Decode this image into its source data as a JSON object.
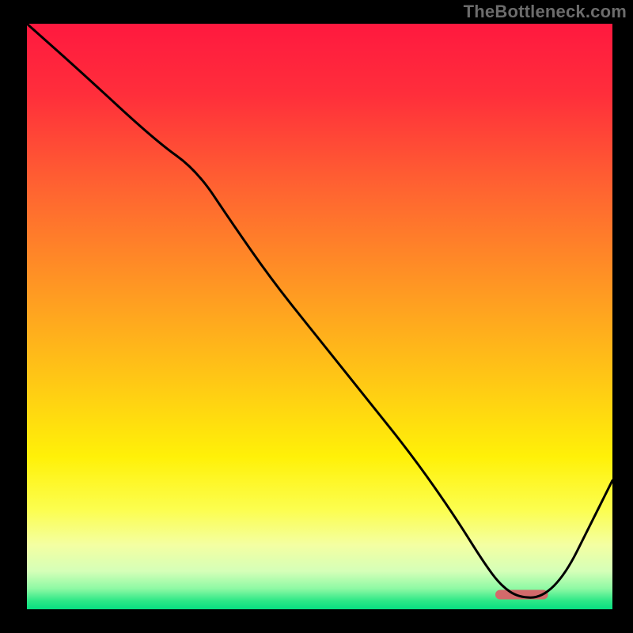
{
  "watermark": "TheBottleneck.com",
  "chart_data": {
    "type": "line",
    "title": "",
    "xlabel": "",
    "ylabel": "",
    "xlim": [
      0,
      100
    ],
    "ylim": [
      0,
      100
    ],
    "grid": false,
    "legend": null,
    "background_gradient_stops": [
      {
        "offset": 0.0,
        "color": "#ff193f"
      },
      {
        "offset": 0.12,
        "color": "#ff2e3b"
      },
      {
        "offset": 0.28,
        "color": "#ff6331"
      },
      {
        "offset": 0.45,
        "color": "#ff9723"
      },
      {
        "offset": 0.62,
        "color": "#ffcb14"
      },
      {
        "offset": 0.74,
        "color": "#fff108"
      },
      {
        "offset": 0.83,
        "color": "#fcfe4f"
      },
      {
        "offset": 0.89,
        "color": "#f4ffa2"
      },
      {
        "offset": 0.935,
        "color": "#d5ffb8"
      },
      {
        "offset": 0.965,
        "color": "#8df9a4"
      },
      {
        "offset": 0.985,
        "color": "#2fe887"
      },
      {
        "offset": 1.0,
        "color": "#07de81"
      }
    ],
    "series": [
      {
        "name": "bottleneck-curve",
        "x": [
          0,
          9,
          22,
          29,
          35,
          42,
          50,
          58,
          66,
          73,
          78,
          81,
          84,
          88,
          92,
          96,
          100
        ],
        "y": [
          100,
          92,
          80,
          75,
          66,
          56,
          46,
          36,
          26,
          16,
          8,
          4,
          2,
          2,
          6,
          14,
          22
        ]
      }
    ],
    "marker": {
      "name": "optimal-band",
      "x_start": 80,
      "x_end": 89,
      "y": 2.5,
      "color": "#d36a6b"
    }
  }
}
